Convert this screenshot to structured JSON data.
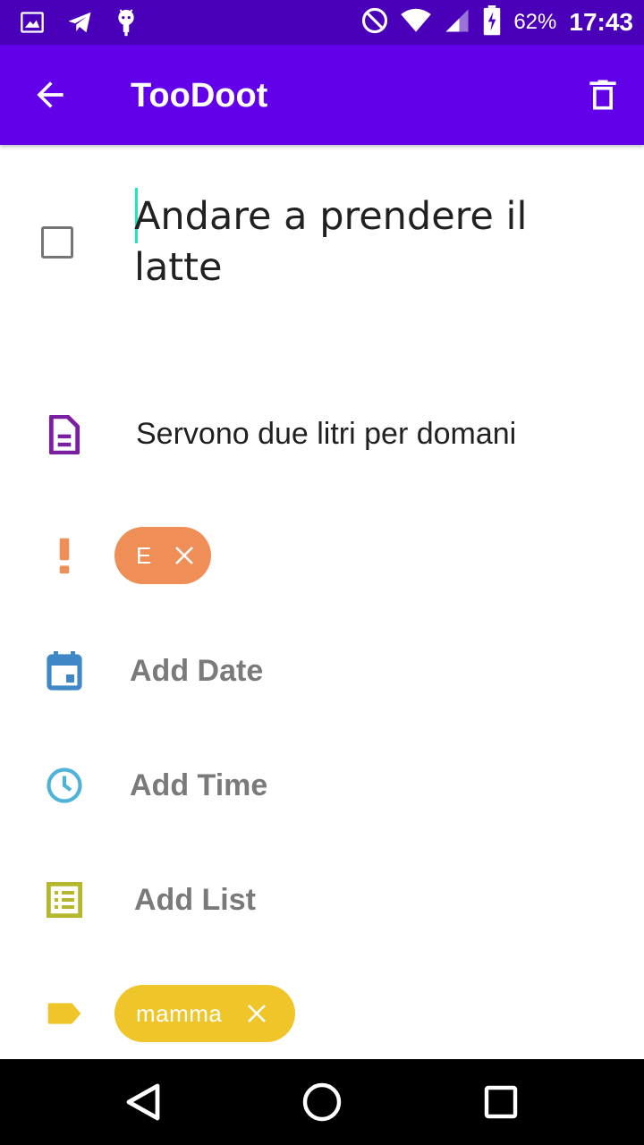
{
  "status_bar": {
    "battery": "62%",
    "time": "17:43",
    "icons": [
      "image-icon",
      "telegram-icon",
      "android-icon",
      "do-not-disturb-icon",
      "wifi-icon",
      "signal-icon",
      "battery-charging-icon"
    ]
  },
  "app_bar": {
    "title": "TooDoot",
    "back_icon": "arrow-back-icon",
    "delete_icon": "trash-icon"
  },
  "task": {
    "checked": false,
    "title": "Andare a prendere il latte"
  },
  "note": {
    "icon": "note-icon",
    "text": "Servono due litri per domani",
    "icon_color": "#7b1fa2"
  },
  "priority": {
    "icon": "exclamation-icon",
    "label": "E",
    "color": "#ef8f57"
  },
  "date": {
    "icon": "calendar-icon",
    "label": "Add Date",
    "icon_color": "#3f88c5"
  },
  "time": {
    "icon": "clock-icon",
    "label": "Add Time",
    "icon_color": "#4fb3d9"
  },
  "list": {
    "icon": "list-icon",
    "label": "Add List",
    "icon_color": "#b5b82c"
  },
  "tag": {
    "icon": "label-icon",
    "label": "mamma",
    "color": "#efc52a"
  },
  "colors": {
    "status_bar": "#4a00b8",
    "app_bar": "#6200ea",
    "caret": "#1de9b6"
  },
  "nav_bar": {
    "icons": [
      "back-triangle-icon",
      "home-circle-icon",
      "recents-square-icon"
    ]
  }
}
